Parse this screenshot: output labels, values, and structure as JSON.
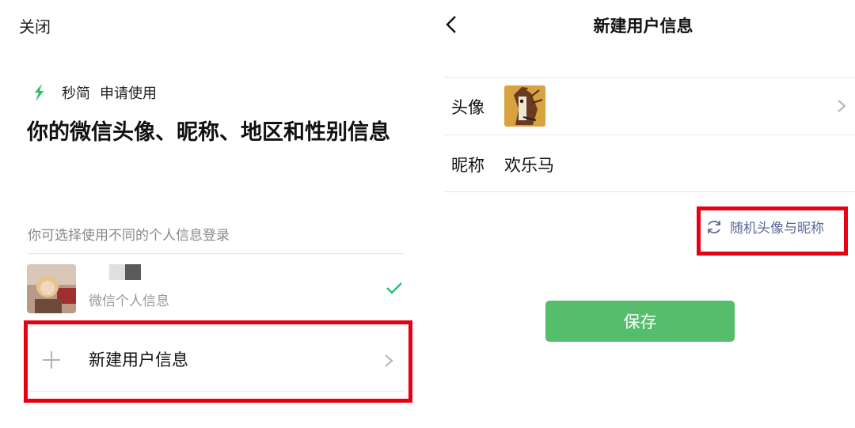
{
  "left": {
    "close_label": "关闭",
    "app_name": "秒简",
    "apply_text": "申请使用",
    "title": "你的微信头像、昵称、地区和性别信息",
    "hint": "你可选择使用不同的个人信息登录",
    "profile": {
      "subtitle": "微信个人信息",
      "selected": true
    },
    "new_user_label": "新建用户信息"
  },
  "right": {
    "title": "新建用户信息",
    "avatar_label": "头像",
    "nickname_label": "昵称",
    "nickname_value": "欢乐马",
    "random_label": "随机头像与昵称",
    "save_label": "保存"
  },
  "icons": [
    "app-logo-icon",
    "check-icon",
    "plus-icon",
    "chevron-right-icon",
    "back-icon",
    "refresh-icon"
  ],
  "colors": {
    "accent_green": "#55bd6b",
    "link_blue": "#576b95",
    "highlight_red": "#e60012",
    "logo_green": "#2dbd5a"
  }
}
